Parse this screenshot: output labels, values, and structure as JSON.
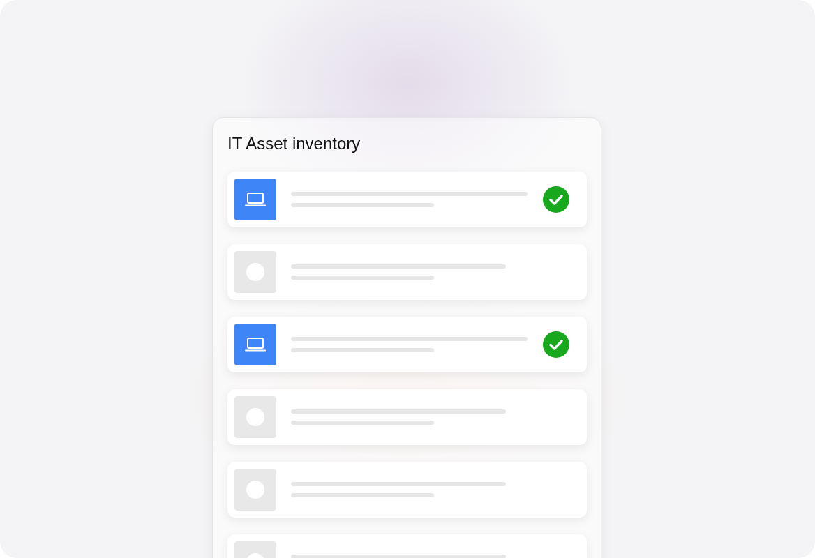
{
  "title": "IT Asset inventory",
  "assets": [
    {
      "kind": "laptop",
      "checked": true
    },
    {
      "kind": "placeholder",
      "checked": false
    },
    {
      "kind": "laptop",
      "checked": true
    },
    {
      "kind": "placeholder",
      "checked": false
    },
    {
      "kind": "placeholder",
      "checked": false
    },
    {
      "kind": "placeholder",
      "checked": false
    }
  ]
}
